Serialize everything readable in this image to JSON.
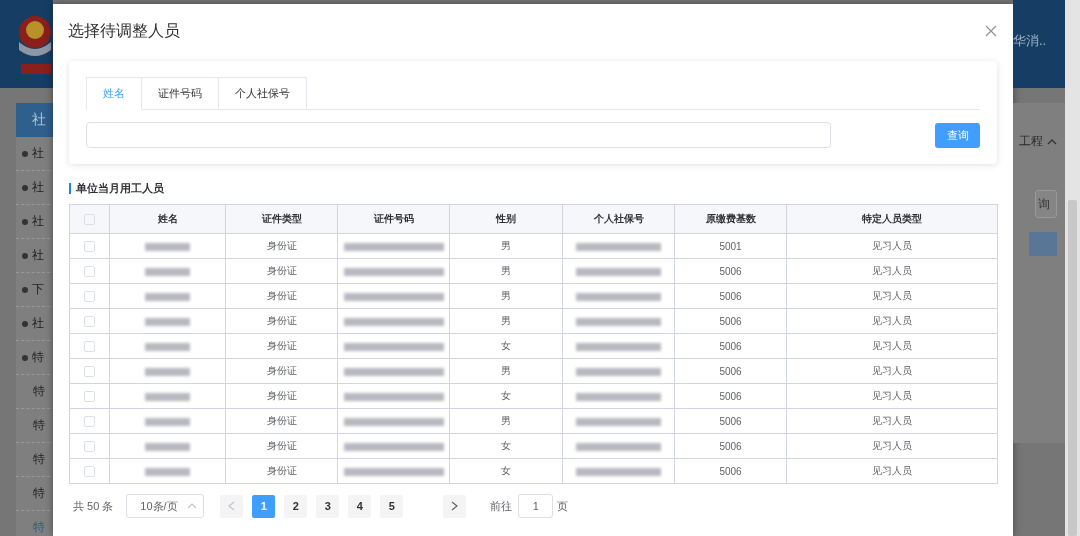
{
  "background": {
    "header_text": "华消..",
    "sidebar": {
      "title": "社",
      "items": [
        {
          "label": "社",
          "kind": "bullet",
          "selected": false
        },
        {
          "label": "社",
          "kind": "bullet",
          "selected": false
        },
        {
          "label": "社",
          "kind": "bullet",
          "selected": false
        },
        {
          "label": "社",
          "kind": "bullet",
          "selected": false
        },
        {
          "label": "下",
          "kind": "bullet",
          "selected": false
        },
        {
          "label": "社",
          "kind": "bullet",
          "selected": false
        },
        {
          "label": "特",
          "kind": "bullet",
          "selected": false
        },
        {
          "label": "特",
          "kind": "sub",
          "selected": false
        },
        {
          "label": "特",
          "kind": "sub",
          "selected": false
        },
        {
          "label": "特",
          "kind": "sub",
          "selected": false
        },
        {
          "label": "特",
          "kind": "sub",
          "selected": false
        },
        {
          "label": "特",
          "kind": "sub",
          "selected": true
        }
      ]
    },
    "right_panel": {
      "section": "工程",
      "button": "询"
    }
  },
  "dialog": {
    "title": "选择待调整人员",
    "tabs": [
      {
        "label": "姓名",
        "selected": true
      },
      {
        "label": "证件号码",
        "selected": false
      },
      {
        "label": "个人社保号",
        "selected": false
      }
    ],
    "search_button": "查询",
    "section_title": "单位当月用工人员",
    "table": {
      "all_checked": false,
      "columns": [
        "姓名",
        "证件类型",
        "证件号码",
        "性别",
        "个人社保号",
        "原缴费基数",
        "特定人员类型"
      ],
      "rows": [
        {
          "checked": false,
          "cells": [
            {
              "kind": "blurred"
            },
            {
              "kind": "text",
              "text": "身份证"
            },
            {
              "kind": "blurred"
            },
            {
              "kind": "text",
              "text": "男"
            },
            {
              "kind": "blurred"
            },
            {
              "kind": "text",
              "text": "5001"
            },
            {
              "kind": "text",
              "text": "见习人员"
            }
          ]
        },
        {
          "checked": false,
          "cells": [
            {
              "kind": "blurred"
            },
            {
              "kind": "text",
              "text": "身份证"
            },
            {
              "kind": "blurred"
            },
            {
              "kind": "text",
              "text": "男"
            },
            {
              "kind": "blurred"
            },
            {
              "kind": "text",
              "text": "5006"
            },
            {
              "kind": "text",
              "text": "见习人员"
            }
          ]
        },
        {
          "checked": false,
          "cells": [
            {
              "kind": "blurred"
            },
            {
              "kind": "text",
              "text": "身份证"
            },
            {
              "kind": "blurred"
            },
            {
              "kind": "text",
              "text": "男"
            },
            {
              "kind": "blurred"
            },
            {
              "kind": "text",
              "text": "5006"
            },
            {
              "kind": "text",
              "text": "见习人员"
            }
          ]
        },
        {
          "checked": false,
          "cells": [
            {
              "kind": "blurred"
            },
            {
              "kind": "text",
              "text": "身份证"
            },
            {
              "kind": "blurred"
            },
            {
              "kind": "text",
              "text": "男"
            },
            {
              "kind": "blurred"
            },
            {
              "kind": "text",
              "text": "5006"
            },
            {
              "kind": "text",
              "text": "见习人员"
            }
          ]
        },
        {
          "checked": false,
          "cells": [
            {
              "kind": "blurred"
            },
            {
              "kind": "text",
              "text": "身份证"
            },
            {
              "kind": "blurred"
            },
            {
              "kind": "text",
              "text": "女"
            },
            {
              "kind": "blurred"
            },
            {
              "kind": "text",
              "text": "5006"
            },
            {
              "kind": "text",
              "text": "见习人员"
            }
          ]
        },
        {
          "checked": false,
          "cells": [
            {
              "kind": "blurred"
            },
            {
              "kind": "text",
              "text": "身份证"
            },
            {
              "kind": "blurred"
            },
            {
              "kind": "text",
              "text": "男"
            },
            {
              "kind": "blurred"
            },
            {
              "kind": "text",
              "text": "5006"
            },
            {
              "kind": "text",
              "text": "见习人员"
            }
          ]
        },
        {
          "checked": false,
          "cells": [
            {
              "kind": "blurred"
            },
            {
              "kind": "text",
              "text": "身份证"
            },
            {
              "kind": "blurred"
            },
            {
              "kind": "text",
              "text": "女"
            },
            {
              "kind": "blurred"
            },
            {
              "kind": "text",
              "text": "5006"
            },
            {
              "kind": "text",
              "text": "见习人员"
            }
          ]
        },
        {
          "checked": false,
          "cells": [
            {
              "kind": "blurred"
            },
            {
              "kind": "text",
              "text": "身份证"
            },
            {
              "kind": "blurred"
            },
            {
              "kind": "text",
              "text": "男"
            },
            {
              "kind": "blurred"
            },
            {
              "kind": "text",
              "text": "5006"
            },
            {
              "kind": "text",
              "text": "见习人员"
            }
          ]
        },
        {
          "checked": false,
          "cells": [
            {
              "kind": "blurred"
            },
            {
              "kind": "text",
              "text": "身份证"
            },
            {
              "kind": "blurred"
            },
            {
              "kind": "text",
              "text": "女"
            },
            {
              "kind": "blurred"
            },
            {
              "kind": "text",
              "text": "5006"
            },
            {
              "kind": "text",
              "text": "见习人员"
            }
          ]
        },
        {
          "checked": false,
          "cells": [
            {
              "kind": "blurred"
            },
            {
              "kind": "text",
              "text": "身份证"
            },
            {
              "kind": "blurred"
            },
            {
              "kind": "text",
              "text": "女"
            },
            {
              "kind": "blurred"
            },
            {
              "kind": "text",
              "text": "5006"
            },
            {
              "kind": "text",
              "text": "见习人员"
            }
          ]
        }
      ]
    },
    "pagination": {
      "total": "共 50 条",
      "page_size": "10条/页",
      "pages": [
        {
          "label": "1",
          "selected": true
        },
        {
          "label": "2",
          "selected": false
        },
        {
          "label": "3",
          "selected": false
        },
        {
          "label": "4",
          "selected": false
        },
        {
          "label": "5",
          "selected": false
        }
      ],
      "goto_label": "前往",
      "goto_value": "1",
      "goto_suffix": "页"
    }
  }
}
